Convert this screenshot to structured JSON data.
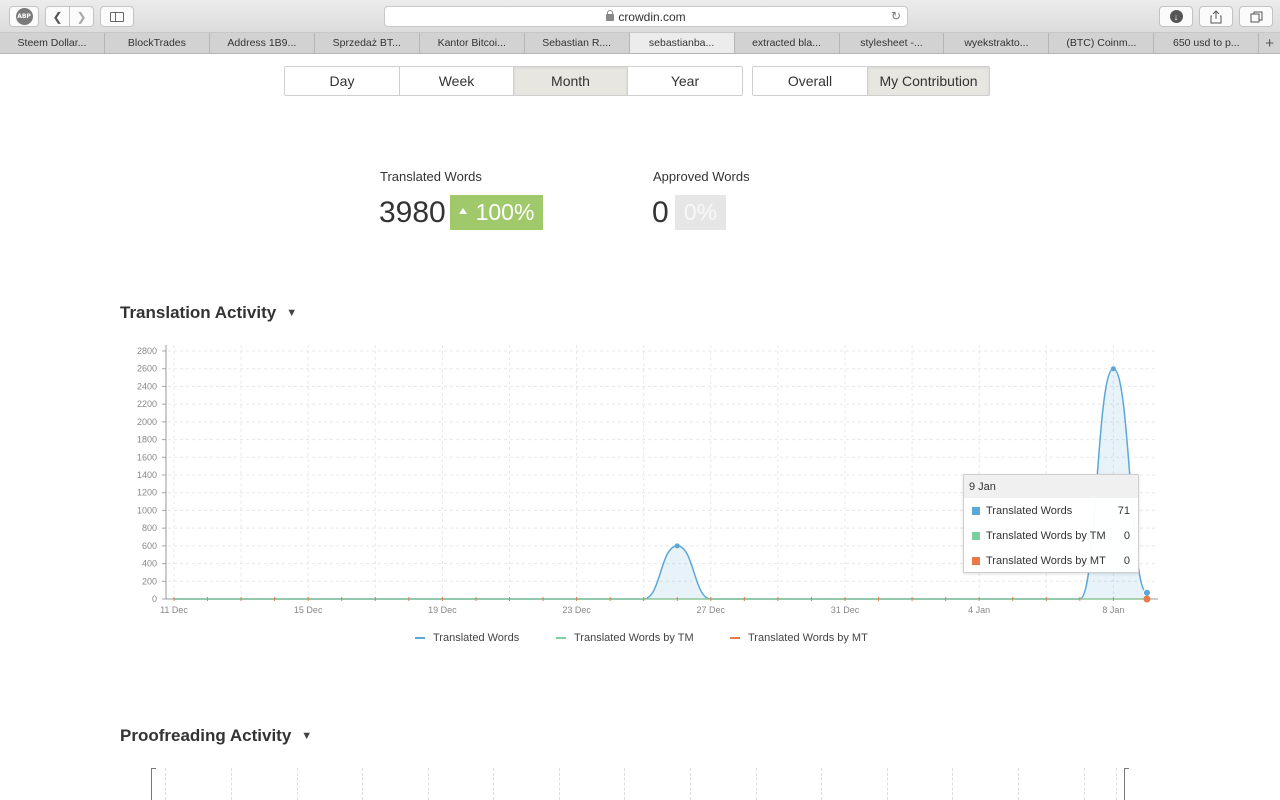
{
  "browser": {
    "url": "crowdin.com",
    "tabs": [
      "Steem Dollar...",
      "BlockTrades",
      "Address 1B9...",
      "Sprzedaż BT...",
      "Kantor Bitcoi...",
      "Sebastian R....",
      "sebastianba...",
      "extracted bla...",
      "stylesheet -...",
      "wyekstrakto...",
      "(BTC) Coinm...",
      "650 usd to p..."
    ],
    "active_tab": 6,
    "adblock_label": "ABP"
  },
  "periods": {
    "items": [
      "Day",
      "Week",
      "Month",
      "Year"
    ],
    "selected": "Month"
  },
  "scope": {
    "items": [
      "Overall",
      "My Contribution"
    ],
    "selected": "My Contribution"
  },
  "stats": {
    "translated": {
      "label": "Translated Words",
      "value": "3980",
      "change": "100%",
      "color": "#a0c96b"
    },
    "approved": {
      "label": "Approved Words",
      "value": "0",
      "change": "0%",
      "color": "#e6e6e6"
    }
  },
  "sections": {
    "translation": "Translation Activity",
    "proofreading": "Proofreading Activity"
  },
  "chart_data": {
    "type": "area",
    "y_ticks": [
      0,
      200,
      400,
      600,
      800,
      1000,
      1200,
      1400,
      1600,
      1800,
      2000,
      2200,
      2400,
      2600,
      2800
    ],
    "x_ticks": [
      "11 Dec",
      "15 Dec",
      "19 Dec",
      "23 Dec",
      "27 Dec",
      "31 Dec",
      "4 Jan",
      "8 Jan"
    ],
    "ylim": [
      0,
      2800
    ],
    "grid": true,
    "series": [
      {
        "name": "Translated Words",
        "color": "#5ba7d6",
        "x": [
          "11 Dec",
          "12 Dec",
          "13 Dec",
          "14 Dec",
          "15 Dec",
          "16 Dec",
          "17 Dec",
          "18 Dec",
          "19 Dec",
          "20 Dec",
          "21 Dec",
          "22 Dec",
          "23 Dec",
          "24 Dec",
          "25 Dec",
          "26 Dec",
          "27 Dec",
          "28 Dec",
          "29 Dec",
          "30 Dec",
          "31 Dec",
          "1 Jan",
          "2 Jan",
          "3 Jan",
          "4 Jan",
          "5 Jan",
          "6 Jan",
          "7 Jan",
          "8 Jan",
          "9 Jan"
        ],
        "values": [
          0,
          0,
          0,
          0,
          0,
          0,
          0,
          0,
          0,
          0,
          0,
          0,
          0,
          0,
          0,
          600,
          0,
          0,
          0,
          0,
          0,
          0,
          0,
          0,
          0,
          0,
          0,
          0,
          2600,
          71
        ]
      },
      {
        "name": "Translated Words by TM",
        "color": "#7dcea0",
        "x": [
          "11 Dec",
          "12 Dec",
          "13 Dec",
          "14 Dec",
          "15 Dec",
          "16 Dec",
          "17 Dec",
          "18 Dec",
          "19 Dec",
          "20 Dec",
          "21 Dec",
          "22 Dec",
          "23 Dec",
          "24 Dec",
          "25 Dec",
          "26 Dec",
          "27 Dec",
          "28 Dec",
          "29 Dec",
          "30 Dec",
          "31 Dec",
          "1 Jan",
          "2 Jan",
          "3 Jan",
          "4 Jan",
          "5 Jan",
          "6 Jan",
          "7 Jan",
          "8 Jan",
          "9 Jan"
        ],
        "values": [
          0,
          0,
          0,
          0,
          0,
          0,
          0,
          0,
          0,
          0,
          0,
          0,
          0,
          0,
          0,
          0,
          0,
          0,
          0,
          0,
          0,
          0,
          0,
          0,
          0,
          0,
          0,
          0,
          0,
          0
        ]
      },
      {
        "name": "Translated Words by MT",
        "color": "#e8794a",
        "x": [
          "11 Dec",
          "12 Dec",
          "13 Dec",
          "14 Dec",
          "15 Dec",
          "16 Dec",
          "17 Dec",
          "18 Dec",
          "19 Dec",
          "20 Dec",
          "21 Dec",
          "22 Dec",
          "23 Dec",
          "24 Dec",
          "25 Dec",
          "26 Dec",
          "27 Dec",
          "28 Dec",
          "29 Dec",
          "30 Dec",
          "31 Dec",
          "1 Jan",
          "2 Jan",
          "3 Jan",
          "4 Jan",
          "5 Jan",
          "6 Jan",
          "7 Jan",
          "8 Jan",
          "9 Jan"
        ],
        "values": [
          0,
          0,
          0,
          0,
          0,
          0,
          0,
          0,
          0,
          0,
          0,
          0,
          0,
          0,
          0,
          0,
          0,
          0,
          0,
          0,
          0,
          0,
          0,
          0,
          0,
          0,
          0,
          0,
          0,
          0
        ]
      }
    ],
    "tooltip": {
      "date": "9 Jan",
      "rows": [
        {
          "name": "Translated Words",
          "value": "71",
          "color": "#5ba7d6"
        },
        {
          "name": "Translated Words by TM",
          "value": "0",
          "color": "#7dcea0"
        },
        {
          "name": "Translated Words by MT",
          "value": "0",
          "color": "#e8794a"
        }
      ]
    }
  }
}
